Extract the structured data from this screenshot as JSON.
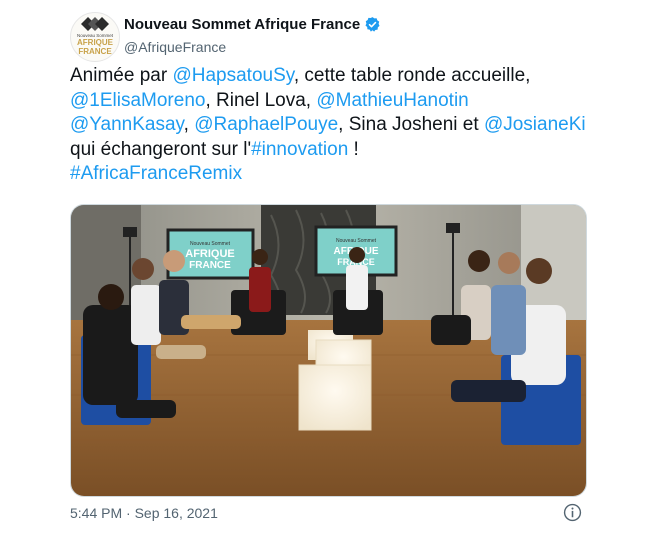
{
  "account": {
    "display_name": "Nouveau Sommet Afrique France",
    "handle": "@AfriqueFrance",
    "avatar_lines": [
      "Nouveau Sommet",
      "AFRIQUE",
      "FRANCE"
    ]
  },
  "tweet": {
    "text_parts": [
      {
        "t": "Animée par ",
        "link": false
      },
      {
        "t": "@HapsatouSy",
        "link": true
      },
      {
        "t": ", cette table ronde accueille,",
        "link": false
      },
      {
        "br": true
      },
      {
        "t": "@1ElisaMoreno",
        "link": true
      },
      {
        "t": ", Rinel Lova, ",
        "link": false
      },
      {
        "t": "@MathieuHanotin",
        "link": true
      },
      {
        "br": true
      },
      {
        "t": "@YannKasay",
        "link": true
      },
      {
        "t": ", ",
        "link": false
      },
      {
        "t": "@RaphaelPouye",
        "link": true
      },
      {
        "t": ", Sina Josheni et ",
        "link": false
      },
      {
        "t": "@JosianeKi",
        "link": true
      },
      {
        "br": true
      },
      {
        "t": "qui échangeront sur l'",
        "link": false
      },
      {
        "t": "#innovation",
        "link": true
      },
      {
        "t": " !",
        "link": false
      },
      {
        "br": true
      },
      {
        "t": "#AfricaFranceRemix",
        "link": true
      }
    ],
    "screen_text": [
      "Nouveau Sommet",
      "AFRIQUE",
      "FRANCE"
    ],
    "timestamp": "5:44 PM · Sep 16, 2021"
  },
  "icons": {
    "verified": "verified-badge-icon",
    "info": "info-icon"
  },
  "colors": {
    "link": "#1d9bf0",
    "text": "#0f1419",
    "muted": "#536471",
    "gold": "#c8a24a"
  }
}
